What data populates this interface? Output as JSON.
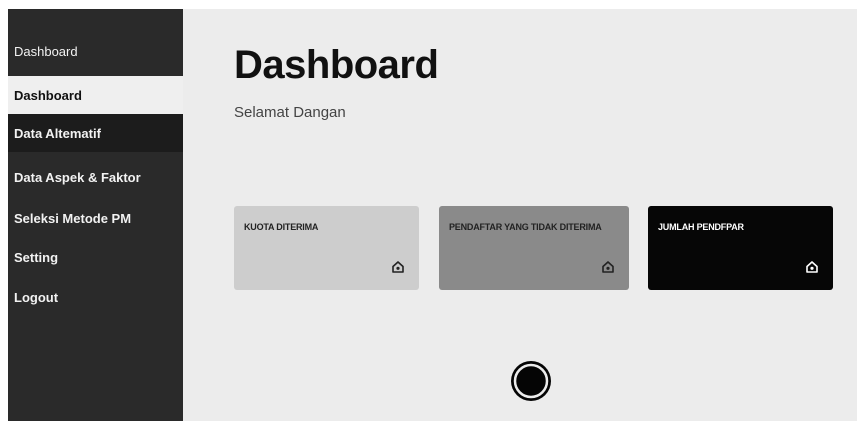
{
  "sidebar": {
    "title": "Dashboard",
    "items": [
      {
        "label": "Dashboard"
      },
      {
        "label": "Data Altematif"
      },
      {
        "label": "Data Aspek & Faktor"
      },
      {
        "label": "Seleksi Metode PM"
      },
      {
        "label": "Setting"
      },
      {
        "label": "Logout"
      }
    ]
  },
  "header": {
    "title": "Dashboard",
    "subtitle": "Selamat Dangan"
  },
  "cards": [
    {
      "label": "KUOTA DITERIMA",
      "icon": "home-icon"
    },
    {
      "label": "PENDAFTAR YANG TIDAK DITERIMA",
      "icon": "home-icon"
    },
    {
      "label": "JUMLAH PENDFPAR",
      "icon": "home-icon"
    }
  ],
  "colors": {
    "sidebar_bg": "#2a2a2a",
    "active_item_bg": "#efefef",
    "main_bg": "#ececec",
    "card1_bg": "#cdcdcd",
    "card2_bg": "#8a8a8a",
    "card3_bg": "#060606"
  }
}
